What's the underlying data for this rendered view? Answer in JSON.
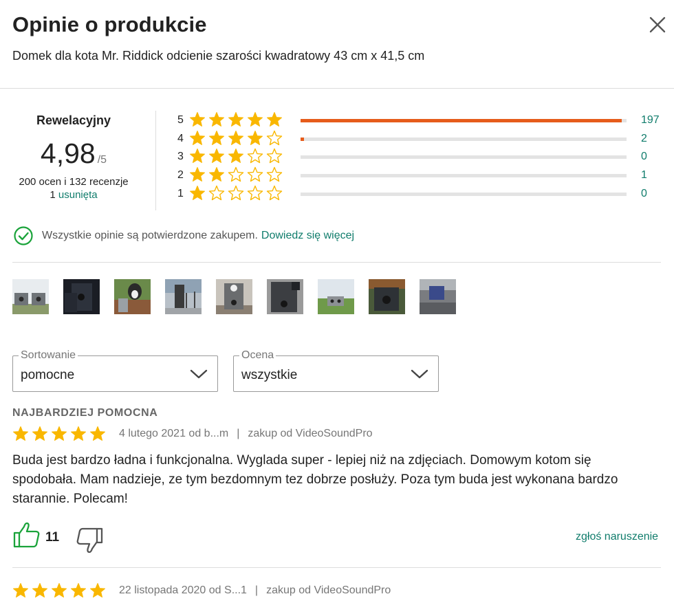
{
  "header": {
    "title": "Opinie o produkcie",
    "product_name": "Domek dla kota Mr. Riddick odcienie szarości kwadratowy 43 cm x 41,5 cm"
  },
  "summary": {
    "label": "Rewelacyjny",
    "score": "4,98",
    "score_max": "/5",
    "counts": "200 ocen i 132 recenzje",
    "removed_count": "1",
    "removed_link": "usunięta"
  },
  "distribution": [
    {
      "stars": "5",
      "filled": 5,
      "count": "197",
      "fraction": 0.985
    },
    {
      "stars": "4",
      "filled": 4,
      "count": "2",
      "fraction": 0.01
    },
    {
      "stars": "3",
      "filled": 3,
      "count": "0",
      "fraction": 0
    },
    {
      "stars": "2",
      "filled": 2,
      "count": "1",
      "fraction": 0
    },
    {
      "stars": "1",
      "filled": 1,
      "count": "0",
      "fraction": 0
    }
  ],
  "verified": {
    "text": "Wszystkie opinie są potwierdzone zakupem.",
    "link": "Dowiedz się więcej",
    "icon": "check-circle-icon"
  },
  "photos": [
    {
      "name": "photo-1"
    },
    {
      "name": "photo-2"
    },
    {
      "name": "photo-3"
    },
    {
      "name": "photo-4"
    },
    {
      "name": "photo-5"
    },
    {
      "name": "photo-6"
    },
    {
      "name": "photo-7"
    },
    {
      "name": "photo-8"
    },
    {
      "name": "photo-9"
    }
  ],
  "filters": {
    "sort": {
      "legend": "Sortowanie",
      "value": "pomocne"
    },
    "rating": {
      "legend": "Ocena",
      "value": "wszystkie"
    }
  },
  "reviews": [
    {
      "section_label": "NAJBARDZIEJ POMOCNA",
      "stars": 5,
      "date_author": "4 lutego 2021 od b...m",
      "separator": "|",
      "seller": "zakup od VideoSoundPro",
      "text": "Buda jest bardzo ładna i funkcjonalna. Wyglada super - lepiej niż na zdjęciach. Domowym kotom się spodobała. Mam nadzieje, ze tym bezdomnym tez dobrze posłuży. Poza tym buda jest wykonana bardzo starannie. Polecam!",
      "helpful_count": "11",
      "report": "zgłoś naruszenie"
    },
    {
      "stars": 5,
      "date_author": "22 listopada 2020 od S...1",
      "separator": "|",
      "seller": "zakup od VideoSoundPro"
    }
  ],
  "colors": {
    "star": "#f9b700",
    "bar_fill": "#e65c1b",
    "link": "#0f7c6b",
    "thumb_up": "#1aa33a"
  }
}
